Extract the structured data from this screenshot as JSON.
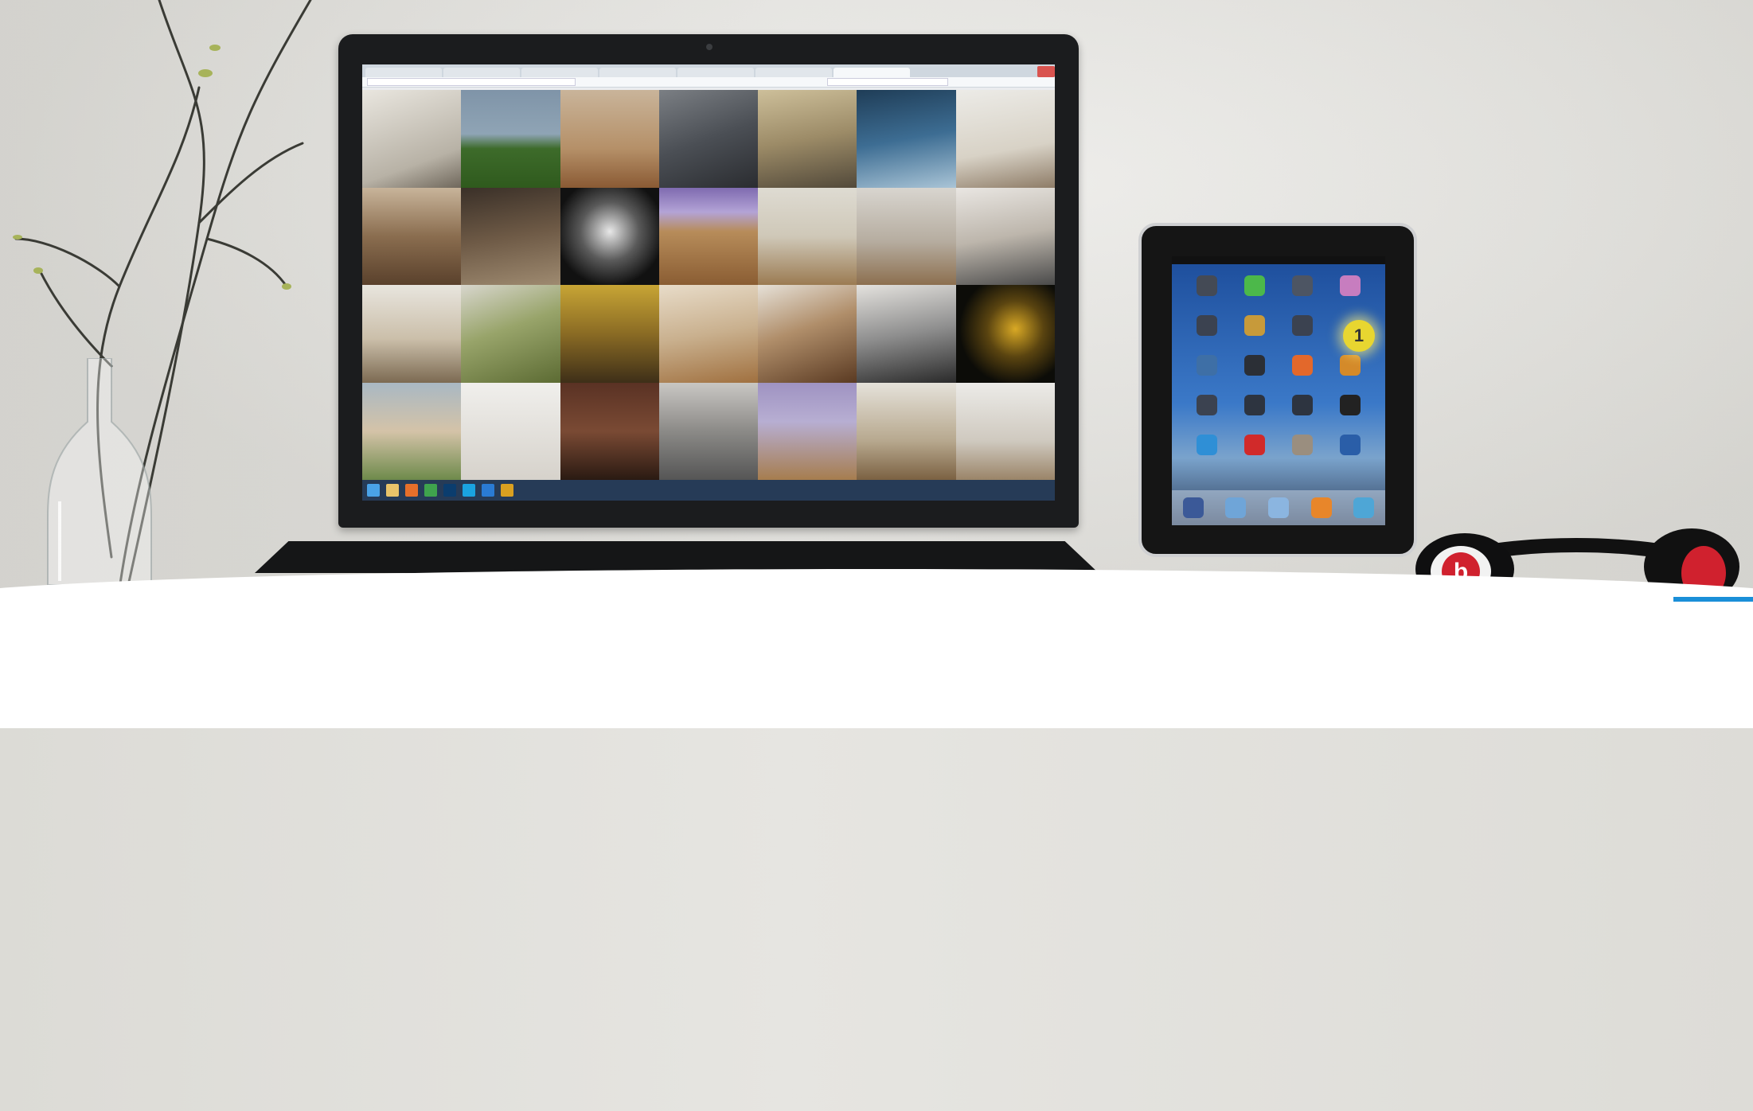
{
  "scene": {
    "laptop": {
      "browser_tabs": [
        "",
        "",
        "",
        "",
        "",
        "",
        "",
        ""
      ],
      "taskbar_time": ""
    },
    "tablet": {
      "badge_number": "1"
    },
    "headphones": {
      "brand_mark": "b"
    }
  },
  "colors": {
    "wall": "#e2e1dc",
    "desk": "#ffffff",
    "laptop_body": "#1b1c1e",
    "taskbar": "#263b57",
    "ipad_bezel": "#151515",
    "highlight_badge": "#e8d630",
    "headphone_accent": "#d0212e"
  }
}
